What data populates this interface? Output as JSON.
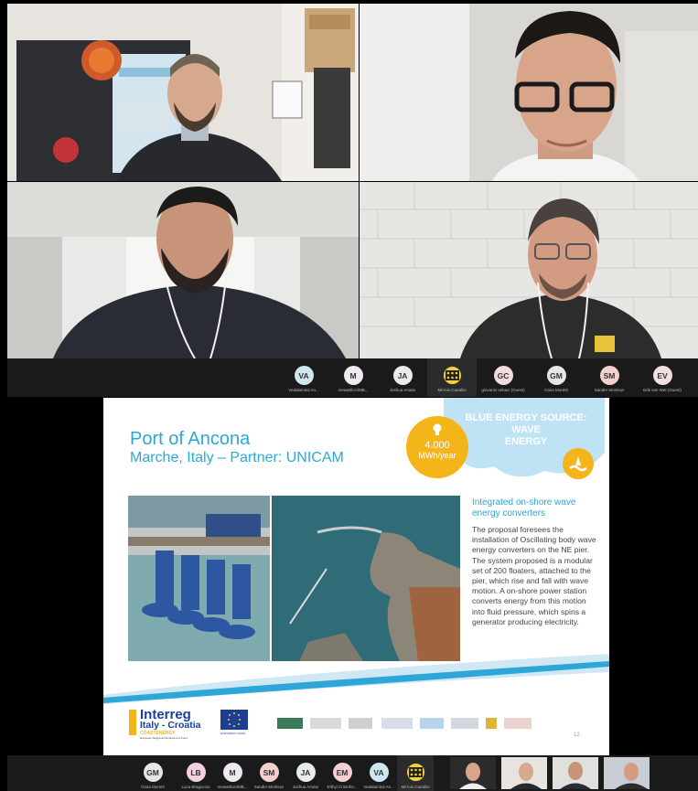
{
  "gallery_top": {
    "participants": [
      {
        "initials": "VA",
        "name": "Vedalamitol An...",
        "color": "#cfe7ef"
      },
      {
        "initials": "M",
        "name": "mewatt/UniMB...",
        "color": "#efe9f2"
      },
      {
        "initials": "JA",
        "name": "Joshua Amato",
        "color": "#e8ecec"
      },
      {
        "initials": "",
        "name": "Mirrois Canalini",
        "color": "#f3d13a",
        "logo": true
      },
      {
        "initials": "GC",
        "name": "giovanni sehaci (Guest)",
        "color": "#f4dada"
      },
      {
        "initials": "GM",
        "name": "Gioia Moretti",
        "color": "#e6e6e6"
      },
      {
        "initials": "SM",
        "name": "Sander Moritsus",
        "color": "#f4d0cc"
      },
      {
        "initials": "EV",
        "name": "Erik van Wet (Guest)",
        "color": "#f3dede"
      }
    ]
  },
  "gallery_bottom": {
    "participants": [
      {
        "initials": "GM",
        "name": "Gioia Moretti",
        "color": "#e6e6e6"
      },
      {
        "initials": "LB",
        "name": "Luca Bragoccio",
        "color": "#f4d0e0"
      },
      {
        "initials": "M",
        "name": "mewatt/UniMB...",
        "color": "#efe9f2"
      },
      {
        "initials": "SM",
        "name": "Sander Moritsus",
        "color": "#f4d0cc"
      },
      {
        "initials": "JA",
        "name": "Joshua Amato",
        "color": "#e8ecec"
      },
      {
        "initials": "EM",
        "name": "Efthyi Cristofor...",
        "color": "#f4cfd3"
      },
      {
        "initials": "VA",
        "name": "Vedalamitol An...",
        "color": "#cfe7ef"
      },
      {
        "initials": "",
        "name": "Mirrois Canalini",
        "color": "#f3d13a",
        "logo": true
      }
    ]
  },
  "slide": {
    "title": "Port of Ancona",
    "subtitle": "Marche, Italy – Partner: UNICAM",
    "energy_value": "4.000",
    "energy_unit": "MWh/year",
    "source_line1": "BLUE ENERGY SOURCE:",
    "source_line2": "WAVE",
    "source_line3": "ENERGY",
    "desc_heading": "Integrated on-shore wave energy converters",
    "desc_text": "The proposal foresees the installation of Oscillating body wave energy converters on the NE pier. The system proposed is a modular set of 200 floaters, attached to the pier, which rise and fall with wave motion. A on-shore power station converts energy from this motion into fluid pressure, which spins a generator producing electricity.",
    "footer": {
      "interreg": "Interreg",
      "program": "Italy - Croatia",
      "project": "COASTENERGY",
      "fund": "European Regional Development Fund",
      "eu_label": "EUROPEAN UNION"
    },
    "page_number": "12"
  },
  "colors": {
    "accent_blue": "#2ea7d8",
    "accent_yellow": "#f3b51a",
    "cloud": "#bfe3f5"
  }
}
